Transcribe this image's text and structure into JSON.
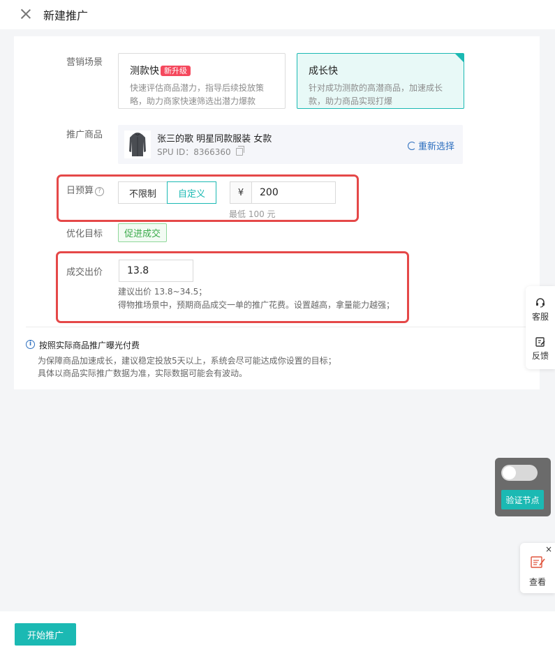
{
  "header": {
    "title": "新建推广"
  },
  "scene": {
    "label": "营销场景",
    "options": [
      {
        "title": "测款快",
        "badge": "新升级",
        "desc": "快速评估商品潜力，指导后续投放策略，助力商家快速筛选出潜力爆款"
      },
      {
        "title": "成长快",
        "desc": "针对成功测款的高潜商品，加速成长款，助力商品实现打爆"
      }
    ]
  },
  "product": {
    "label": "推广商品",
    "name": "张三的歌 明星同款服装 女款",
    "spu": "SPU ID：8366360",
    "reselect": "重新选择"
  },
  "budget": {
    "label": "日预算",
    "help": "?",
    "unlimited": "不限制",
    "custom": "自定义",
    "currency": "¥",
    "value": "200",
    "hint": "最低 100 元"
  },
  "goal": {
    "label": "优化目标",
    "tag": "促进成交"
  },
  "bid": {
    "label": "成交出价",
    "value": "13.8",
    "hint1": "建议出价 13.8~34.5；",
    "hint2": "得物推场景中，预期商品成交一单的推广花费。设置越高，拿量能力越强；"
  },
  "info": {
    "icon": "i",
    "title": "按照实际商品推广曝光付费",
    "line1": "为保障商品加速成长，建议稳定投放5天以上，系统会尽可能达成你设置的目标；",
    "line2": "具体以商品实际推广数据为准，实际数据可能会有波动。"
  },
  "side": {
    "service": "客服",
    "feedback": "反馈"
  },
  "verify": {
    "button": "验证节点"
  },
  "view": {
    "close": "×",
    "label": "查看"
  },
  "footer": {
    "start": "开始推广"
  },
  "colors": {
    "accent": "#1bb9b3",
    "highlight": "#e54848",
    "badge": "#f5485d",
    "link": "#2d6fbf"
  }
}
